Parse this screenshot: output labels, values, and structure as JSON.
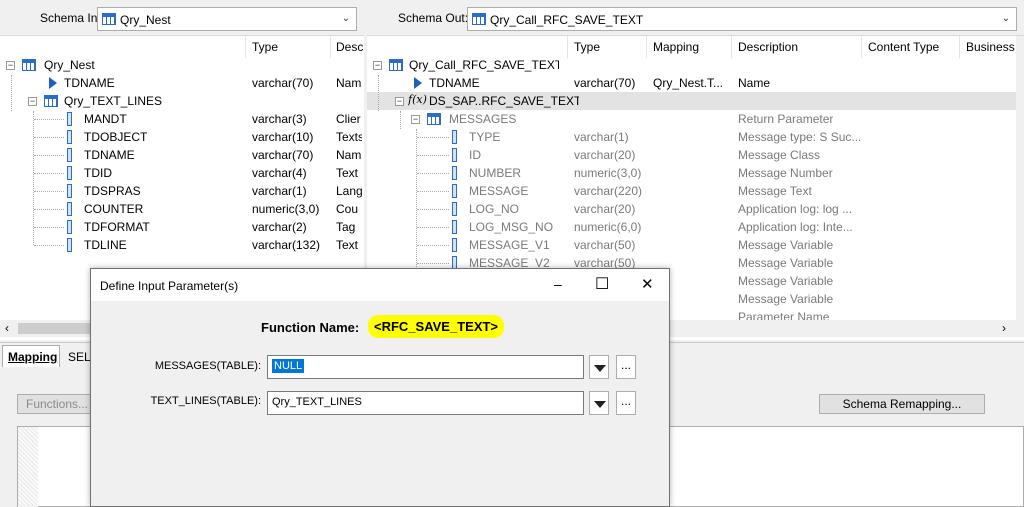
{
  "schema_in": {
    "label": "Schema In:",
    "value": "Qry_Nest",
    "columns": [
      "Type",
      "Desc"
    ],
    "rows": [
      {
        "name": "Qry_Nest",
        "type": "",
        "desc": ""
      },
      {
        "name": "TDNAME",
        "type": "varchar(70)",
        "desc": "Nam"
      },
      {
        "name": "Qry_TEXT_LINES",
        "type": "",
        "desc": ""
      },
      {
        "name": "MANDT",
        "type": "varchar(3)",
        "desc": "Clier"
      },
      {
        "name": "TDOBJECT",
        "type": "varchar(10)",
        "desc": "Texts"
      },
      {
        "name": "TDNAME",
        "type": "varchar(70)",
        "desc": "Nam"
      },
      {
        "name": "TDID",
        "type": "varchar(4)",
        "desc": "Text"
      },
      {
        "name": "TDSPRAS",
        "type": "varchar(1)",
        "desc": "Lang"
      },
      {
        "name": "COUNTER",
        "type": "numeric(3,0)",
        "desc": "Cou"
      },
      {
        "name": "TDFORMAT",
        "type": "varchar(2)",
        "desc": "Tag"
      },
      {
        "name": "TDLINE",
        "type": "varchar(132)",
        "desc": "Text"
      }
    ]
  },
  "schema_out": {
    "label": "Schema Out:",
    "value": "Qry_Call_RFC_SAVE_TEXT",
    "columns": [
      "Type",
      "Mapping",
      "Description",
      "Content Type",
      "Business"
    ],
    "rows": [
      {
        "name": "Qry_Call_RFC_SAVE_TEXT",
        "type": "",
        "mapping": "",
        "desc": ""
      },
      {
        "name": "TDNAME",
        "type": "varchar(70)",
        "mapping": "Qry_Nest.T...",
        "desc": "Name"
      },
      {
        "name": "DS_SAP..RFC_SAVE_TEXT",
        "type": "",
        "mapping": "",
        "desc": ""
      },
      {
        "name": "MESSAGES",
        "type": "",
        "mapping": "",
        "desc": "Return Parameter"
      },
      {
        "name": "TYPE",
        "type": "varchar(1)",
        "mapping": "",
        "desc": "Message type: S Suc..."
      },
      {
        "name": "ID",
        "type": "varchar(20)",
        "mapping": "",
        "desc": "Message Class"
      },
      {
        "name": "NUMBER",
        "type": "numeric(3,0)",
        "mapping": "",
        "desc": "Message Number"
      },
      {
        "name": "MESSAGE",
        "type": "varchar(220)",
        "mapping": "",
        "desc": "Message Text"
      },
      {
        "name": "LOG_NO",
        "type": "varchar(20)",
        "mapping": "",
        "desc": "Application log: log ..."
      },
      {
        "name": "LOG_MSG_NO",
        "type": "numeric(6,0)",
        "mapping": "",
        "desc": "Application log: Inte..."
      },
      {
        "name": "MESSAGE_V1",
        "type": "varchar(50)",
        "mapping": "",
        "desc": "Message Variable"
      },
      {
        "name": "MESSAGE_V2",
        "type": "varchar(50)",
        "mapping": "",
        "desc": "Message Variable"
      },
      {
        "name": "",
        "type": "",
        "mapping": "",
        "desc": "Message Variable"
      },
      {
        "name": "",
        "type": "",
        "mapping": "",
        "desc": "Message Variable"
      },
      {
        "name": "",
        "type": "",
        "mapping": "",
        "desc": "Parameter Name"
      }
    ]
  },
  "bottom": {
    "tab_mapping": "Mapping",
    "tab_select": "SELE",
    "functions_button": "Functions...",
    "schema_remapping_button": "Schema Remapping..."
  },
  "dialog": {
    "title": "Define Input Parameter(s)",
    "function_label": "Function Name:",
    "function_name": "<RFC_SAVE_TEXT>",
    "highlight_color": "#ffff00",
    "params": [
      {
        "label": "MESSAGES(TABLE):",
        "value": "NULL"
      },
      {
        "label": "TEXT_LINES(TABLE):",
        "value": "Qry_TEXT_LINES"
      }
    ],
    "ellipsis": "...",
    "minimize": "–",
    "maximize": "☐",
    "close": "✕"
  }
}
